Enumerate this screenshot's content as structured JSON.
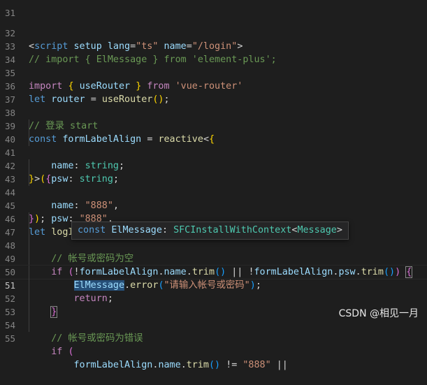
{
  "editor": {
    "lines": [
      {
        "n": "31",
        "code": ""
      },
      {
        "n": "32",
        "code": "<script setup lang=\"ts\" name=\"/login\">"
      },
      {
        "n": "33",
        "code": "// import { ElMessage } from 'element-plus';"
      },
      {
        "n": "34",
        "code": ""
      },
      {
        "n": "35",
        "code": "import { useRouter } from 'vue-router'"
      },
      {
        "n": "36",
        "code": "let router = useRouter();"
      },
      {
        "n": "37",
        "code": ""
      },
      {
        "n": "38",
        "code": "// 登录 start"
      },
      {
        "n": "39",
        "code": "const formLabelAlign = reactive<{"
      },
      {
        "n": "40",
        "code": "    name: string;"
      },
      {
        "n": "41",
        "code": "    psw: string;"
      },
      {
        "n": "42",
        "code": "}>({"
      },
      {
        "n": "43",
        "code": "    name: \"888\","
      },
      {
        "n": "44",
        "code": "    psw: \"888\","
      },
      {
        "n": "45",
        "code": "});"
      },
      {
        "n": "46",
        "code": "let logIn = () => {"
      },
      {
        "n": "47",
        "code": "    // 帐号或密码为空"
      },
      {
        "n": "48",
        "code": "    if (!formLabelAlign.name.trim() || !formLabelAlign.psw.trim()) {"
      },
      {
        "n": "49",
        "code": "        ElMessage.error(\"请输入帐号或密码\");"
      },
      {
        "n": "50",
        "code": "        return;"
      },
      {
        "n": "51",
        "code": "    }"
      },
      {
        "n": "52",
        "code": ""
      },
      {
        "n": "53",
        "code": "    // 帐号或密码为错误"
      },
      {
        "n": "54",
        "code": "    if ("
      },
      {
        "n": "55",
        "code": "        formLabelAlign.name.trim() != \"888\" ||"
      }
    ],
    "current_line": "51"
  },
  "hover": {
    "kw": "const",
    "name": "ElMessage",
    "colon": ":",
    "type": "SFCInstallWithContext",
    "lt": "<",
    "generic": "Message",
    "gt": ">"
  },
  "watermark": "CSDN @相见一月"
}
